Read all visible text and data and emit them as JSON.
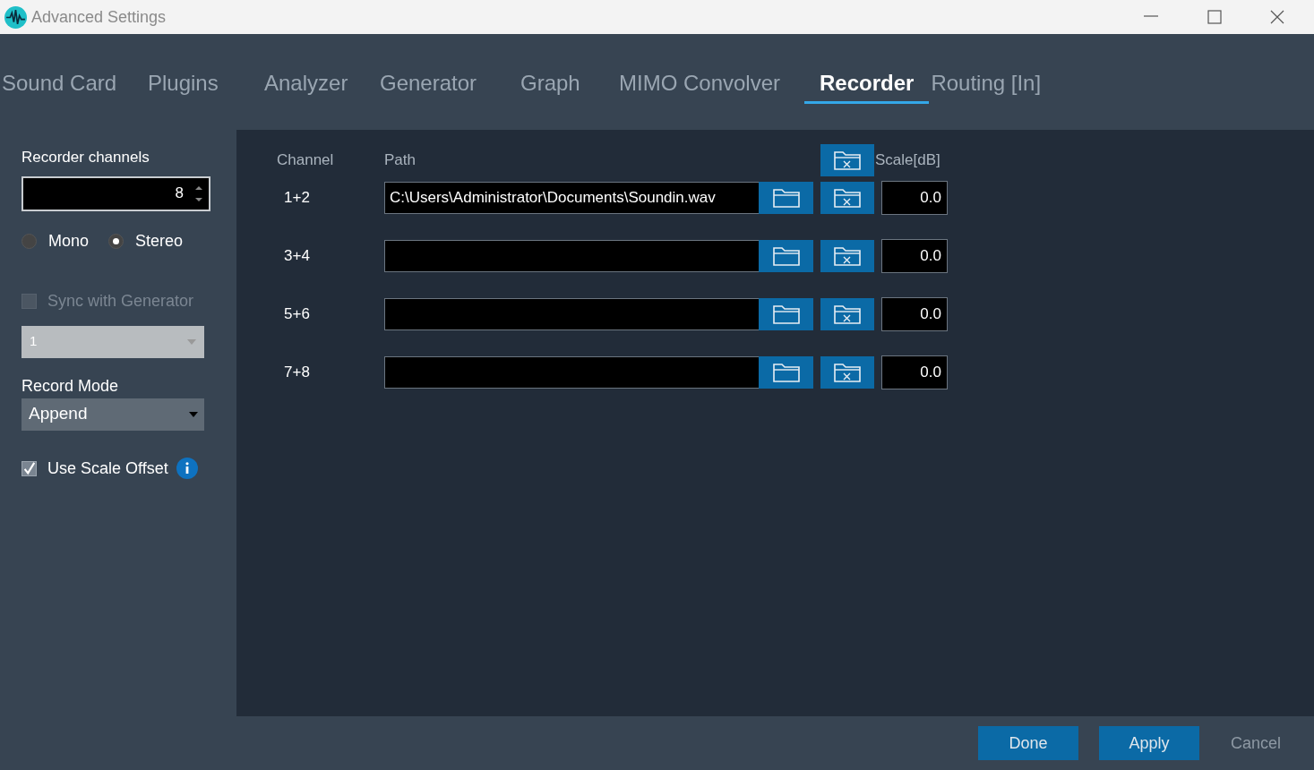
{
  "window": {
    "title": "Advanced Settings"
  },
  "tabs": [
    {
      "label": "Sound Card",
      "selected": false
    },
    {
      "label": "Plugins",
      "selected": false
    },
    {
      "label": "Analyzer",
      "selected": false
    },
    {
      "label": "Generator",
      "selected": false
    },
    {
      "label": "Graph",
      "selected": false
    },
    {
      "label": "MIMO Convolver",
      "selected": false
    },
    {
      "label": "Recorder",
      "selected": true
    },
    {
      "label": "Routing [In]",
      "selected": false
    }
  ],
  "sidebar": {
    "channels_label": "Recorder channels",
    "channels_value": "8",
    "modes": [
      {
        "label": "Mono",
        "selected": false
      },
      {
        "label": "Stereo",
        "selected": true
      }
    ],
    "sync": {
      "label": "Sync with Generator",
      "checked": false,
      "disabled": true
    },
    "sync_value": {
      "value": "1",
      "disabled": true
    },
    "record_mode_label": "Record Mode",
    "record_mode": "Append",
    "scale_offset": {
      "label": "Use Scale Offset",
      "checked": true
    }
  },
  "table": {
    "columns": [
      "Channel",
      "Path",
      "Scale[dB]"
    ],
    "rows": [
      {
        "channel": "1+2",
        "path": "C:\\Users\\Administrator\\Documents\\Soundin.wav",
        "scale": "0.0"
      },
      {
        "channel": "3+4",
        "path": "",
        "scale": "0.0"
      },
      {
        "channel": "5+6",
        "path": "",
        "scale": "0.0"
      },
      {
        "channel": "7+8",
        "path": "",
        "scale": "0.0"
      }
    ]
  },
  "buttons": [
    {
      "label": "Done",
      "kind": "primary"
    },
    {
      "label": "Apply",
      "kind": "primary"
    },
    {
      "label": "Cancel",
      "kind": "plain"
    }
  ]
}
